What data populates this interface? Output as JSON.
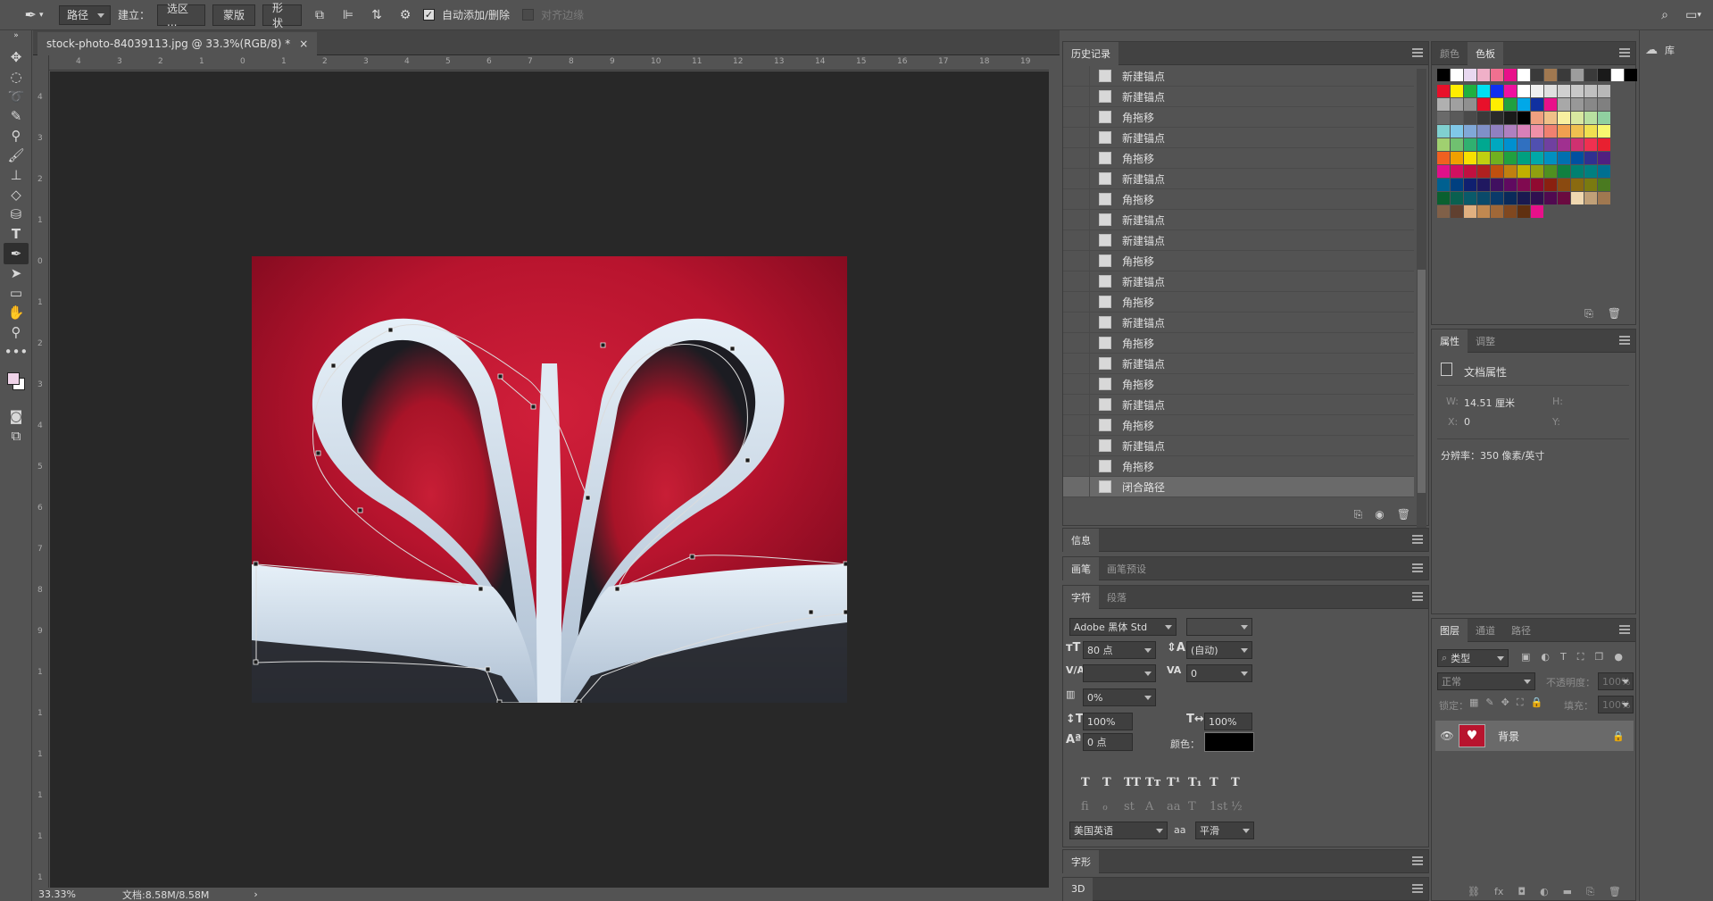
{
  "optionsbar": {
    "mode_select": "路径",
    "make_label": "建立：",
    "selection_button": "选区 ...",
    "mask_button": "蒙版",
    "shape_button": "形状",
    "auto_add_delete_label": "自动添加/删除",
    "auto_add_delete_checked": true,
    "align_edges_label": "对齐边缘",
    "align_edges_checked": false,
    "check_mark": "✓"
  },
  "document": {
    "tab_title": "stock-photo-84039113.jpg @ 33.3%(RGB/8) *",
    "close_glyph": "×",
    "zoom": "33.33%",
    "doc_size": "文档:8.58M/8.58M",
    "status_arrow": "›"
  },
  "rulers": {
    "top": [
      "4",
      "3",
      "2",
      "1",
      "0",
      "1",
      "2",
      "3",
      "4",
      "5",
      "6",
      "7",
      "8",
      "9",
      "10",
      "11",
      "12",
      "13",
      "14",
      "15",
      "16",
      "17",
      "18",
      "19"
    ],
    "left": [
      "4",
      "3",
      "2",
      "1",
      "0",
      "1",
      "2",
      "3",
      "4",
      "5",
      "6",
      "7",
      "8",
      "9",
      "1",
      "1",
      "1",
      "1",
      "1",
      "1"
    ]
  },
  "history": {
    "title": "历史记录",
    "items": [
      "新建锚点",
      "新建锚点",
      "角拖移",
      "新建锚点",
      "角拖移",
      "新建锚点",
      "角拖移",
      "新建锚点",
      "新建锚点",
      "角拖移",
      "新建锚点",
      "角拖移",
      "新建锚点",
      "角拖移",
      "新建锚点",
      "角拖移",
      "新建锚点",
      "角拖移",
      "新建锚点",
      "角拖移",
      "闭合路径"
    ],
    "selected_index": 20
  },
  "swatches_panel": {
    "tabs": [
      "颜色",
      "色板"
    ],
    "active_tab": "色板",
    "rows": [
      [
        "#000000",
        "#ffffff",
        "#e8d8f0",
        "#f0b0c8",
        "#f07090",
        "#e8108a",
        "#ffffff",
        "#3a3a3a",
        "#a07850",
        "#3a3a3a",
        "#9c9c9c",
        "#3a3a3a",
        "#1a1a1a",
        "#ffffff",
        "#000000"
      ],
      [
        "#e8102a",
        "#ffee00",
        "#20b040",
        "#00e0f0",
        "#1030f0",
        "#f010a0",
        "#ffffff",
        "#f0f0f0",
        "#e0e0e0",
        "#d0d0d0",
        "#c8c8c8",
        "#c0c0c0",
        "#b8b8b8"
      ],
      [
        "#b0b0b0",
        "#a0a0a0",
        "#909090",
        "#e8102a",
        "#ffee00",
        "#20a040",
        "#00a8e8",
        "#1030a0",
        "#e8108a",
        "#a8a8a8",
        "#989898",
        "#888888",
        "#808080"
      ],
      [
        "#6a6a6a",
        "#5a5a5a",
        "#4a4a4a",
        "#3a3a3a",
        "#2a2a2a",
        "#1a1a1a",
        "#000000",
        "#f0a080",
        "#f0c088",
        "#f8f0a0",
        "#d8e8a0",
        "#b8e0a0",
        "#90d0a0"
      ],
      [
        "#80d0d0",
        "#80c8e8",
        "#80a8d8",
        "#8090c8",
        "#9080c0",
        "#b080c0",
        "#d880b8",
        "#f090a8",
        "#f08070",
        "#f0a050",
        "#f0c050",
        "#f0e050",
        "#f8f870"
      ],
      [
        "#a0d070",
        "#70c070",
        "#30b070",
        "#00a890",
        "#00a8c0",
        "#0090d0",
        "#3070c0",
        "#5050b0",
        "#7040a0",
        "#a03090",
        "#d03070",
        "#f03050",
        "#e82030"
      ],
      [
        "#f06020",
        "#f0a000",
        "#f8e000",
        "#c0d010",
        "#70b020",
        "#20a040",
        "#00a080",
        "#00a8a8",
        "#0090c0",
        "#0070b0",
        "#0050a0",
        "#303090",
        "#502080"
      ],
      [
        "#e0108a",
        "#d01060",
        "#c01040",
        "#b02020",
        "#c05010",
        "#c08010",
        "#c0b000",
        "#90a010",
        "#509020",
        "#108040",
        "#008070",
        "#008080",
        "#007090"
      ],
      [
        "#006090",
        "#004080",
        "#102070",
        "#201860",
        "#401060",
        "#600a60",
        "#800a50",
        "#900a30",
        "#8a2010",
        "#8a4a10",
        "#8a6a10",
        "#7a7a10",
        "#4a7a20"
      ],
      [
        "#0a6030",
        "#0a6050",
        "#0a5a6a",
        "#0a4a6a",
        "#0a3a6a",
        "#0a2a5a",
        "#1a1a50",
        "#301050",
        "#500a50",
        "#6a0a40",
        "#f0d8b0",
        "#c0a078",
        "#a07850"
      ],
      [
        "#806048",
        "#604030",
        "#e0b080",
        "#c08850",
        "#a06838",
        "#804820",
        "#603010",
        "#e8108a"
      ]
    ]
  },
  "properties": {
    "tabs": [
      "属性",
      "调整"
    ],
    "active_tab": "属性",
    "section": "文档属性",
    "w_label": "W:",
    "w_value": "14.51 厘米",
    "h_label": "H:",
    "x_label": "X:",
    "x_value": "0",
    "y_label": "Y:",
    "resolution": "分辨率：350 像素/英寸"
  },
  "info_panel": {
    "title": "信息"
  },
  "brush_panel": {
    "tabs": [
      "画笔",
      "画笔预设"
    ]
  },
  "character": {
    "tabs": [
      "字符",
      "段落"
    ],
    "font_family": "Adobe 黑体 Std",
    "font_size": "80 点",
    "leading": "(自动)",
    "kerning": "",
    "tracking": "0",
    "scale_percent": "0%",
    "vertical_scale": "100%",
    "horizontal_scale": "100%",
    "baseline_shift": "0 点",
    "color_label": "颜色：",
    "color": "#000000",
    "style_buttons": [
      "T",
      "T",
      "TT",
      "Tт",
      "T¹",
      "T₁",
      "T",
      "T"
    ],
    "opentype_buttons": [
      "fi",
      "ℴ",
      "st",
      "A",
      "aa",
      "T",
      "1st",
      "½"
    ],
    "language": "美国英语",
    "aa_label": "aa",
    "antialias": "平滑"
  },
  "glyphs_panel": {
    "title": "字形"
  },
  "panel_3d": {
    "title": "3D"
  },
  "layers": {
    "tabs": [
      "图层",
      "通道",
      "路径"
    ],
    "active_tab": "图层",
    "filter_placeholder": "类型",
    "blend_mode": "正常",
    "opacity_label": "不透明度：",
    "opacity_value": "100%",
    "lock_label": "锁定：",
    "fill_label": "填充：",
    "fill_value": "100%",
    "layer_name": "背景"
  },
  "libraries": {
    "label": "库"
  },
  "colors": {
    "accent_red": "#b8142e",
    "panel_bg": "#535353",
    "canvas_bg": "#282828"
  }
}
